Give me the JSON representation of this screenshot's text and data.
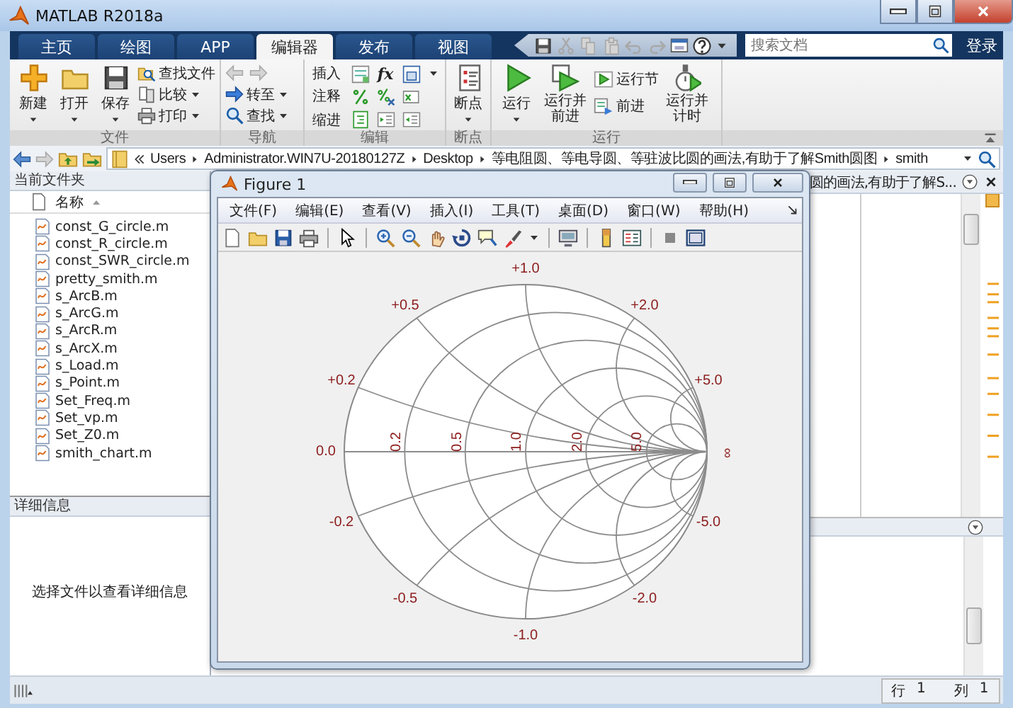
{
  "window": {
    "title": "MATLAB R2018a"
  },
  "tabs": [
    {
      "label": "主页",
      "selected": false
    },
    {
      "label": "绘图",
      "selected": false
    },
    {
      "label": "APP",
      "selected": false
    },
    {
      "label": "编辑器",
      "selected": true
    },
    {
      "label": "发布",
      "selected": false
    },
    {
      "label": "视图",
      "selected": false
    }
  ],
  "quick_access": [
    {
      "kind": "save",
      "disabled": false
    },
    {
      "kind": "cut",
      "disabled": true
    },
    {
      "kind": "copy",
      "disabled": true
    },
    {
      "kind": "paste",
      "disabled": true
    },
    {
      "kind": "undo",
      "disabled": true
    },
    {
      "kind": "redo",
      "disabled": true
    },
    {
      "kind": "windows",
      "disabled": false
    },
    {
      "kind": "help",
      "disabled": false
    }
  ],
  "search": {
    "placeholder": "搜索文档"
  },
  "login": "登录",
  "ribbon": {
    "file": {
      "label": "文件",
      "new": "新建",
      "open": "打开",
      "save": "保存",
      "find_files": "查找文件",
      "compare": "比较",
      "print": "打印"
    },
    "navigate": {
      "label": "导航",
      "history_disabled": true,
      "go_to": "转至",
      "find": "查找"
    },
    "edit": {
      "label": "编辑",
      "insert": "插入",
      "comment": "注释",
      "indent": "缩进",
      "function_symbol": "fx"
    },
    "breakpoints": {
      "label": "断点",
      "breakpoints": "断点"
    },
    "run": {
      "label": "运行",
      "run": "运行",
      "run_advance": "运行并前进",
      "run_section": "运行节",
      "advance": "前进",
      "run_time": "运行并计时"
    }
  },
  "address_bar": {
    "path": [
      "Users",
      "Administrator.WIN7U-20180127Z",
      "Desktop",
      "等电阻圆、等电导圆、等驻波比圆的画法,有助于了解Smith圆图",
      "smith"
    ]
  },
  "current_folder": {
    "title": "当前文件夹",
    "column": "名称",
    "files": [
      "const_G_circle.m",
      "const_R_circle.m",
      "const_SWR_circle.m",
      "pretty_smith.m",
      "s_ArcB.m",
      "s_ArcG.m",
      "s_ArcR.m",
      "s_ArcX.m",
      "s_Load.m",
      "s_Point.m",
      "Set_Freq.m",
      "Set_vp.m",
      "Set_Z0.m",
      "smith_chart.m"
    ]
  },
  "details": {
    "title": "详细信息",
    "message": "选择文件以查看详细信息"
  },
  "editor": {
    "tab_title": "圆的画法,有助于了解S..."
  },
  "figure": {
    "title": "Figure 1",
    "menus": [
      "文件(F)",
      "编辑(E)",
      "查看(V)",
      "插入(I)",
      "工具(T)",
      "桌面(D)",
      "窗口(W)",
      "帮助(H)"
    ],
    "smith_chart": {
      "outer_labels": [
        "+1.0",
        "+0.5",
        "+2.0",
        "+0.2",
        "+5.0",
        "0.0",
        "∞",
        "-0.2",
        "-5.0",
        "-0.5",
        "-2.0",
        "-1.0"
      ],
      "resistance_labels": [
        "0.2",
        "0.5",
        "1.0",
        "2.0",
        "5.0"
      ]
    }
  },
  "status_bar": {
    "row_label": "行",
    "row": "1",
    "column_label": "列",
    "column": "1"
  }
}
